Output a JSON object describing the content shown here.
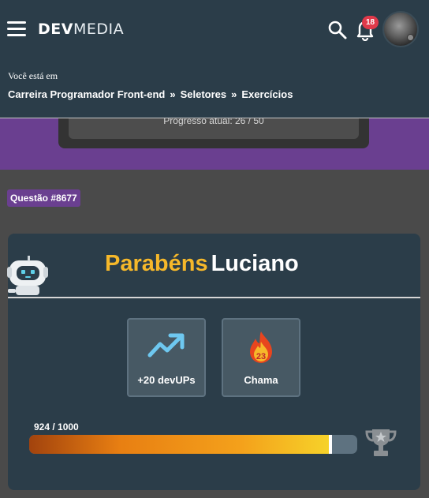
{
  "header": {
    "logo_bold": "DEV",
    "logo_light": "MEDIA",
    "notification_count": "18",
    "breadcrumb_label": "Você está em",
    "breadcrumb": [
      "Carreira Programador Front-end",
      "Seletores",
      "Exercícios"
    ],
    "breadcrumb_separator": "»",
    "icons": [
      "menu-icon",
      "search-icon",
      "bell-icon",
      "avatar"
    ]
  },
  "progress": {
    "label": "Progresso atual:  26 / 50"
  },
  "question": {
    "tag": "Questão #8677"
  },
  "congrats": {
    "greeting": "Parabéns",
    "user_name": "Luciano",
    "rewards": [
      {
        "icon": "trending-up-icon",
        "label": "+20 devUPs"
      },
      {
        "icon": "flame-icon",
        "value": "23",
        "label": "Chama"
      }
    ],
    "points_text": "924 / 1000",
    "points_current": 924,
    "points_max": 1000,
    "trophy_icon": "trophy-icon"
  },
  "colors": {
    "header_bg": "#2b3d49",
    "accent_purple": "#6a3f90",
    "greeting_yellow": "#f6b82a",
    "badge_red": "#e0394a"
  }
}
